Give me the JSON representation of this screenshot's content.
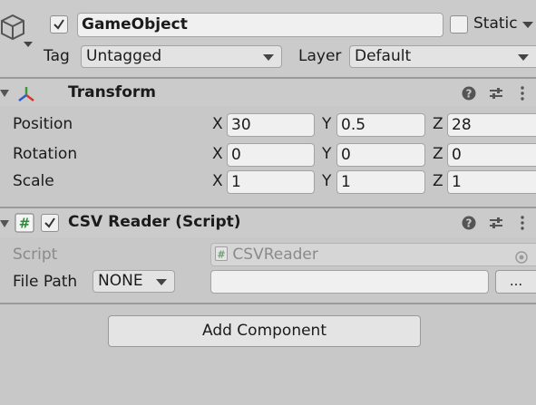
{
  "gameobject": {
    "active": true,
    "name": "GameObject",
    "static_label": "Static",
    "tag_label": "Tag",
    "tag_value": "Untagged",
    "layer_label": "Layer",
    "layer_value": "Default"
  },
  "transform": {
    "title": "Transform",
    "rows": [
      {
        "label": "Position",
        "x": "30",
        "y": "0.5",
        "z": "28"
      },
      {
        "label": "Rotation",
        "x": "0",
        "y": "0",
        "z": "0"
      },
      {
        "label": "Scale",
        "x": "1",
        "y": "1",
        "z": "1"
      }
    ],
    "axis_x": "X",
    "axis_y": "Y",
    "axis_z": "Z"
  },
  "csv_reader": {
    "enabled": true,
    "title": "CSV Reader (Script)",
    "script_label": "Script",
    "script_value": "CSVReader",
    "file_path_label": "File Path",
    "file_path_mode": "NONE",
    "file_path_value": "",
    "browse_label": "..."
  },
  "add_component_label": "Add Component",
  "icons": {
    "help": "help-icon",
    "presets": "presets-icon",
    "menu": "kebab-menu-icon",
    "transform": "transform-icon",
    "script": "script-icon",
    "gameobject": "cube-icon"
  }
}
